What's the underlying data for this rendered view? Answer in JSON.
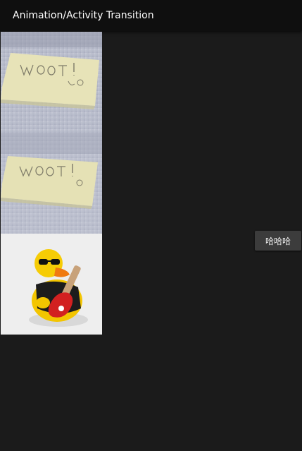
{
  "appbar": {
    "title": "Animation/Activity Transition"
  },
  "images": [
    {
      "icon": "sticky-note-image",
      "text": "WOOT!"
    },
    {
      "icon": "sticky-note-image",
      "text": "WOOT!"
    },
    {
      "icon": "rubber-duck-guitar-image"
    }
  ],
  "action_button": {
    "label": "哈哈哈"
  },
  "colors": {
    "background": "#1b1b1b",
    "appbar": "#0f0f0f",
    "button": "#3c3c3c"
  }
}
